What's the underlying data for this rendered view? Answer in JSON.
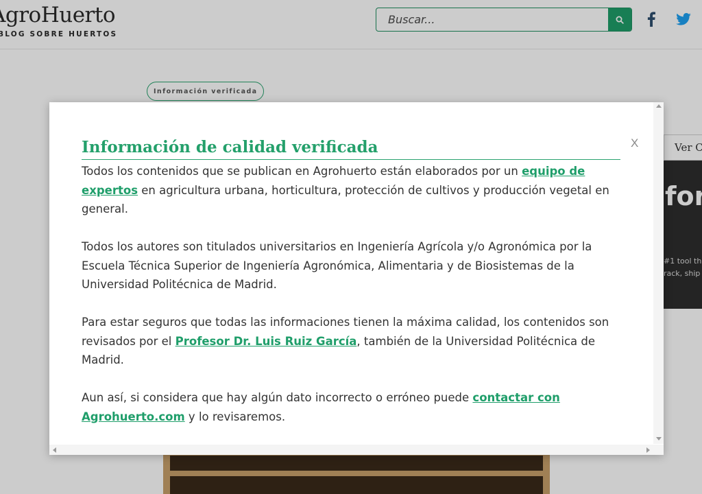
{
  "header": {
    "logo_title": "AgroHuerto",
    "logo_tagline": "BLOG SOBRE HUERTOS",
    "search": {
      "placeholder": "Buscar..."
    },
    "social": [
      "facebook-icon",
      "twitter-icon"
    ]
  },
  "background": {
    "badge": "Información verificada",
    "sidebar_button": "Ver C",
    "ad_text_big": "for",
    "ad_text_small_1": "#1 tool th",
    "ad_text_small_2": "rack, ship"
  },
  "modal": {
    "close_label": "X",
    "title": "Información de calidad verificada",
    "paragraphs": [
      {
        "before": "Todos los contenidos que se publican en Agrohuerto están elaborados por un ",
        "link": "equipo de expertos",
        "after": " en agricultura urbana, horticultura, protección de cultivos y producción vegetal en general."
      },
      {
        "text": "Todos los autores son titulados universitarios en Ingeniería Agrícola y/o Agronómica por la Escuela Técnica Superior de Ingeniería Agronómica, Alimentaria y de Biosistemas de la Universidad Politécnica de Madrid."
      },
      {
        "before": "Para estar seguros que todas las informaciones tienen la máxima calidad, los contenidos son revisados por el ",
        "link": "Profesor Dr. Luis Ruiz García",
        "after": ", también de la Universidad Politécnica de Madrid."
      },
      {
        "before": "Aun así, si considera que hay algún dato incorrecto o erróneo puede ",
        "link": "contactar con Agrohuerto.com",
        "after": " y lo revisaremos."
      }
    ]
  },
  "colors": {
    "brand_green": "#24a06b",
    "text": "#333333",
    "overlay": "rgba(0,0,0,0.2)"
  }
}
